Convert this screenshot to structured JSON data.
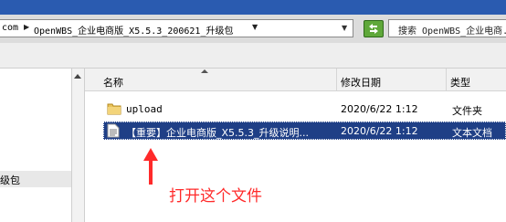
{
  "address": {
    "segments": [
      "com",
      "OpenWBS_企业电商版_X5.5.3_200621_升级包"
    ]
  },
  "search": {
    "text": "搜索 OpenWBS_企业电商..."
  },
  "sidebar": {
    "selected_label": "级包"
  },
  "columns": {
    "name": "名称",
    "modified": "修改日期",
    "type": "类型"
  },
  "files": [
    {
      "name": "upload",
      "modified": "2020/6/22 1:12",
      "type": "文件夹",
      "icon": "folder-icon",
      "selected": false
    },
    {
      "name": "【重要】企业电商版_X5.5.3_升级说明...",
      "modified": "2020/6/22 1:12",
      "type": "文本文档",
      "icon": "text-file-icon",
      "selected": true
    }
  ],
  "annotation": {
    "text": "打开这个文件",
    "color": "#ff2a2a"
  },
  "colors": {
    "selection": "#1f3f86",
    "titlebar": "#2a5bb0",
    "refresh": "#5fa83a"
  }
}
